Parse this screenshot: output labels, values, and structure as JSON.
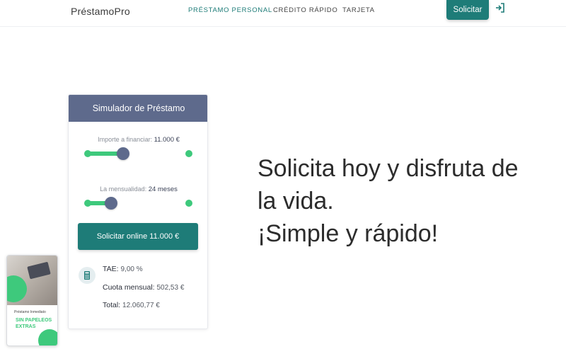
{
  "header": {
    "brand": "PréstamoPro",
    "nav": [
      {
        "label": "PRÉSTAMO PERSONAL",
        "active": true
      },
      {
        "label": "CRÉDITO RÁPIDO",
        "active": false
      },
      {
        "label": "TARJETA",
        "active": false
      }
    ],
    "solicitar_label": "Solicitar",
    "login_icon": "login-icon"
  },
  "simulator": {
    "title": "Simulador de Préstamo",
    "amount": {
      "label": "Importe a financiar:",
      "value": "11.000 €",
      "fill_fraction": 0.35
    },
    "term": {
      "label": "La mensualidad:",
      "value": "24 meses",
      "fill_fraction": 0.23
    },
    "cta_label": "Solicitar online 11.000 €",
    "calc_icon": "calculator-icon",
    "results": [
      {
        "label": "TAE:",
        "value": "9,00 %"
      },
      {
        "label": "Cuota mensual:",
        "value": "502,53 €"
      },
      {
        "label": "Total:",
        "value": "12.060,77 €"
      }
    ]
  },
  "hero": {
    "line1": "Solicita hoy y disfruta de",
    "line2": "la vida.",
    "line3": "¡Simple y rápido!"
  },
  "promo": {
    "small": "Préstamo Inmediato",
    "big": "SIN PAPELEOS EXTRAS"
  },
  "colors": {
    "primary": "#1e7c78",
    "accent": "#3ec97c",
    "slate": "#5e6a8c"
  }
}
